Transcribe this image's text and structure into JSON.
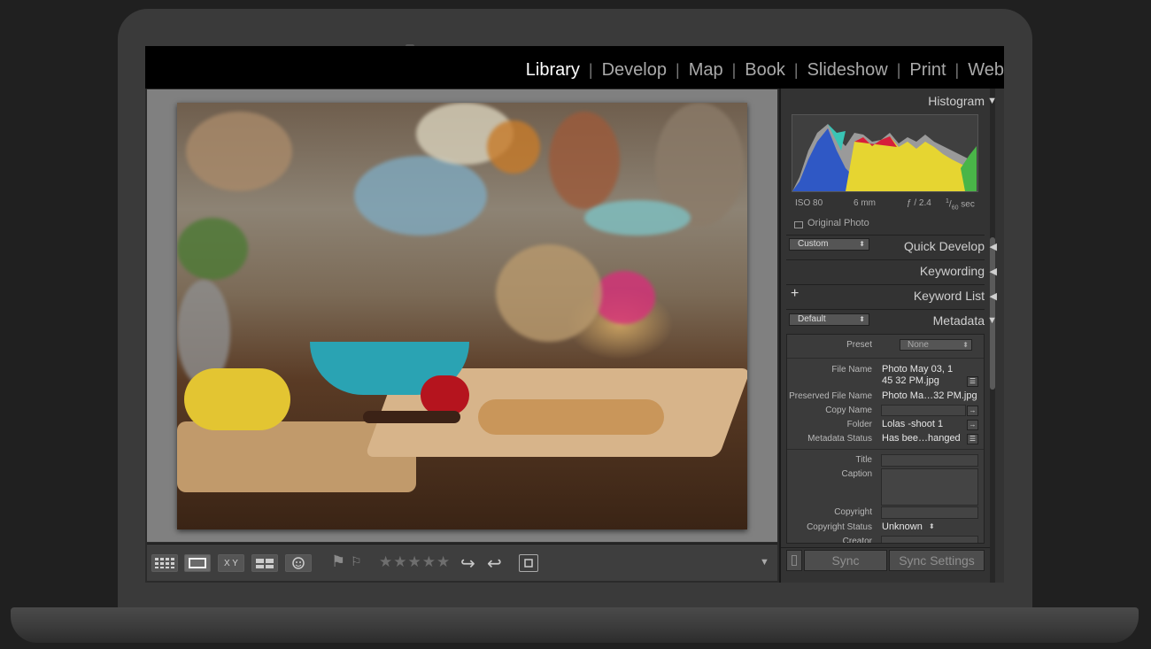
{
  "modules": [
    "Library",
    "Develop",
    "Map",
    "Book",
    "Slideshow",
    "Print",
    "Web"
  ],
  "active_module": "Library",
  "histogram": {
    "title": "Histogram",
    "iso": "ISO 80",
    "focal": "6 mm",
    "aperture": "ƒ / 2.4",
    "shutter_num": "1",
    "shutter_den": "60",
    "shutter_unit": "sec",
    "original_photo_label": "Original Photo"
  },
  "quick_develop": {
    "preset_value": "Custom",
    "title": "Quick Develop"
  },
  "keywording": {
    "title": "Keywording"
  },
  "keyword_list": {
    "add_glyph": "+",
    "title": "Keyword List"
  },
  "metadata": {
    "preset_value": "Default",
    "title": "Metadata",
    "preset_label": "Preset",
    "preset_selected": "None",
    "file_name_label": "File Name",
    "file_name_line1": "Photo May 03, 1",
    "file_name_line2": "45 32 PM.jpg",
    "preserved_label": "Preserved File Name",
    "preserved_value": "Photo Ma…32 PM.jpg",
    "copy_name_label": "Copy Name",
    "folder_label": "Folder",
    "folder_value": "Lolas -shoot 1",
    "status_label": "Metadata Status",
    "status_value": "Has bee…hanged",
    "title_label": "Title",
    "caption_label": "Caption",
    "copyright_label": "Copyright",
    "copyright_status_label": "Copyright Status",
    "copyright_status_value": "Unknown",
    "creator_label": "Creator"
  },
  "sync": {
    "sync_label": "Sync",
    "sync_settings_label": "Sync Settings"
  },
  "toolbar": {
    "stars": "★★★★★",
    "compare_label": "X Y"
  },
  "icons": {
    "collapse": "▼",
    "expand": "◀",
    "grid": "grid-icon",
    "loupe": "loupe-icon",
    "compare": "compare-icon",
    "survey": "survey-icon",
    "people": "people-icon",
    "flag": "flag-icon",
    "reject": "reject-flag-icon",
    "rotate_left": "rotate-left-icon",
    "rotate_right": "rotate-right-icon",
    "crop": "crop-icon",
    "toolbar_menu": "chevron-down-icon"
  },
  "colors": {
    "accent_text": "#ffffff",
    "muted_text": "#a9a9a9",
    "panel_bg": "#333333"
  }
}
